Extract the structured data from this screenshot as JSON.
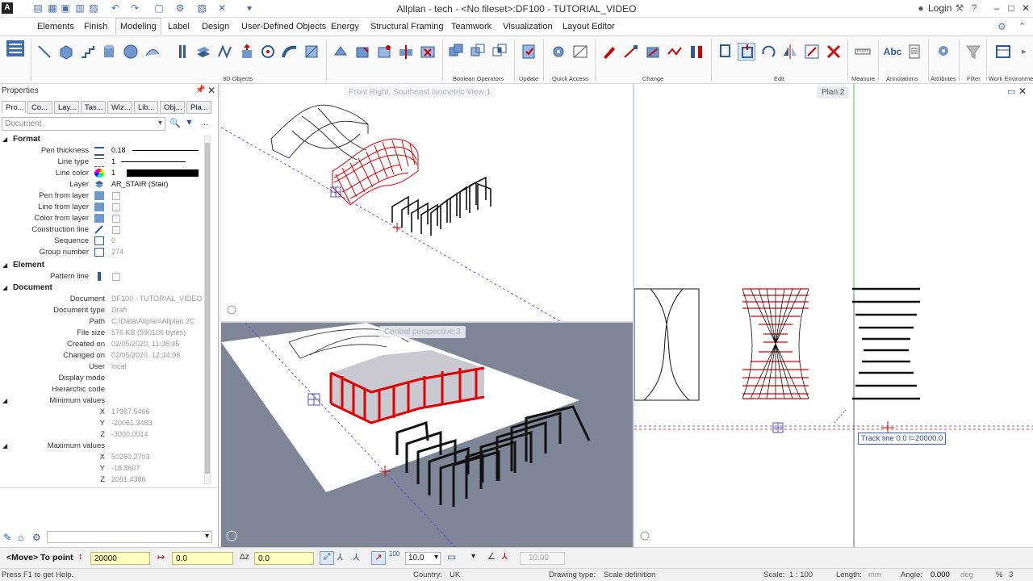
{
  "titlebar": {
    "title": "Allplan - tech - <No fileset>:DF100 - TUTORIAL_VIDEO",
    "login": "Login"
  },
  "menu": {
    "tabs": [
      "Elements",
      "Finish",
      "Modeling",
      "Label",
      "Design",
      "User-Defined Objects",
      "Energy",
      "Structural Framing",
      "Teamwork",
      "Visualization",
      "Layout Editor"
    ],
    "active": "Modeling"
  },
  "ribbon": {
    "groups": [
      "3D Objects",
      "Boolean Operators",
      "Update",
      "Quick Access",
      "Change",
      "Edit",
      "Measure",
      "Annotations",
      "Attributes",
      "Filter",
      "Work Environment"
    ]
  },
  "properties": {
    "title": "Properties",
    "tabs": [
      "Pro...",
      "Co...",
      "Lay...",
      "Tas...",
      "Wiz...",
      "Lib...",
      "Obj...",
      "Pla..."
    ],
    "selector": "Document",
    "sections": {
      "format": "Format",
      "element": "Element",
      "document": "Document"
    },
    "format": {
      "pen_thickness_label": "Pen thickness",
      "pen_thickness": "0.18",
      "line_type_label": "Line type",
      "line_type": "1",
      "line_color_label": "Line color",
      "line_color": "1",
      "layer_label": "Layer",
      "layer": "AR_STAIR (Stair)",
      "pen_from_layer_label": "Pen from layer",
      "line_from_layer_label": "Line from layer",
      "color_from_layer_label": "Color from layer",
      "construction_line_label": "Construction line",
      "sequence_label": "Sequence",
      "sequence": "0",
      "group_number_label": "Group number",
      "group_number": "274"
    },
    "element": {
      "pattern_line_label": "Pattern line"
    },
    "document": {
      "document_label": "Document",
      "document": "DF100 - TUTORIAL_VIDEO",
      "document_type_label": "Document type",
      "document_type": "Draft",
      "path_label": "Path",
      "path": "C:\\Data\\Allplan\\Allplan 2C",
      "file_size_label": "File size",
      "file_size": "576 KB (590106 bytes)",
      "created_on_label": "Created on",
      "created_on": "02/05/2020, 11:36:45",
      "changed_on_label": "Changed on",
      "changed_on": "02/05/2020, 12:34:06",
      "user_label": "User",
      "user": "local",
      "display_mode_label": "Display mode",
      "hierarchic_code_label": "Hierarchic code",
      "min_values_label": "Minimum values",
      "min_x": "17987.5466",
      "min_y": "-20061.3483",
      "min_z": "-3000.0014",
      "max_values_label": "Maximum values",
      "max_x": "50260.2703",
      "max_y": "-18.8607",
      "max_z": "2091.4386",
      "x": "X",
      "y": "Y",
      "z": "Z"
    }
  },
  "viewports": {
    "top_left": "Front Right, Southeast Isometric View:1",
    "bottom_left": "Central perspective:3",
    "right": "Plan:2",
    "tracking_tooltip": "Track line 0.0  l=20000.0"
  },
  "input_bar": {
    "prompt": "<Move> To point",
    "dx": "20000",
    "dy": "0.0",
    "dz_label": "Δz",
    "dz": "0.0",
    "step": "10.0",
    "angle": "10.00"
  },
  "status": {
    "help": "Press F1 to get Help.",
    "country_label": "Country:",
    "country": "UK",
    "drawing_type_label": "Drawing type:",
    "drawing_type": "Scale definition",
    "scale_label": "Scale:",
    "scale": "1 : 100",
    "length_label": "Length:",
    "length": "mm",
    "angle_label": "Angle:",
    "angle": "0.000",
    "angle_unit": "deg",
    "percent": "%",
    "percent_value": "3"
  },
  "colors": {
    "accent": "#c00000",
    "selection_red": "#e00000",
    "viewport_bg": "#7e8597"
  }
}
